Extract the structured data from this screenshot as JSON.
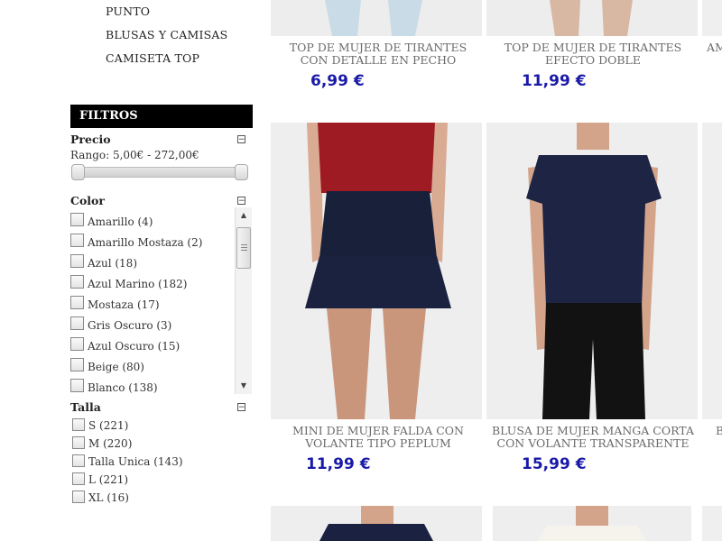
{
  "categories": [
    "PUNTO",
    "BLUSAS Y CAMISAS",
    "CAMISETA TOP"
  ],
  "filters": {
    "title": "FILTROS",
    "price": {
      "label": "Precio",
      "range_text": "Rango: 5,00€ - 272,00€",
      "min": 5.0,
      "max": 272.0,
      "selected_low": 5.0,
      "selected_high": 272.0
    },
    "color": {
      "label": "Color",
      "items": [
        "Amarillo (4)",
        "Amarillo Mostaza (2)",
        "Azul (18)",
        "Azul Marino (182)",
        "Mostaza (17)",
        "Gris Oscuro (3)",
        "Azul Oscuro (15)",
        "Beige (80)",
        "Blanco (138)"
      ]
    },
    "talla": {
      "label": "Talla",
      "items": [
        "S (221)",
        "M (220)",
        "Talla Unica (143)",
        "L (221)",
        "XL (16)"
      ]
    },
    "collapse_symbol": "−"
  },
  "products": {
    "row1": [
      {
        "title": "TOP DE MUJER DE TIRANTES CON DETALLE EN PECHO",
        "price": "6,99 €"
      },
      {
        "title": "TOP DE MUJER DE TIRANTES EFECTO DOBLE",
        "price": "11,99 €"
      },
      {
        "title": "AM"
      }
    ],
    "row2": [
      {
        "title": "MINI DE MUJER FALDA CON VOLANTE TIPO PEPLUM",
        "price": "11,99 €"
      },
      {
        "title": "BLUSA DE MUJER MANGA CORTA CON VOLANTE TRANSPARENTE",
        "price": "15,99 €"
      },
      {
        "title": "B"
      }
    ]
  },
  "colors": {
    "price": "#1a1aa8",
    "filter_bar": "#000000",
    "product_title": "#6b6b6b"
  },
  "icons": {
    "scroll_up": "triangle-up-icon",
    "scroll_down": "triangle-down-icon",
    "collapse": "minus-box-icon"
  }
}
